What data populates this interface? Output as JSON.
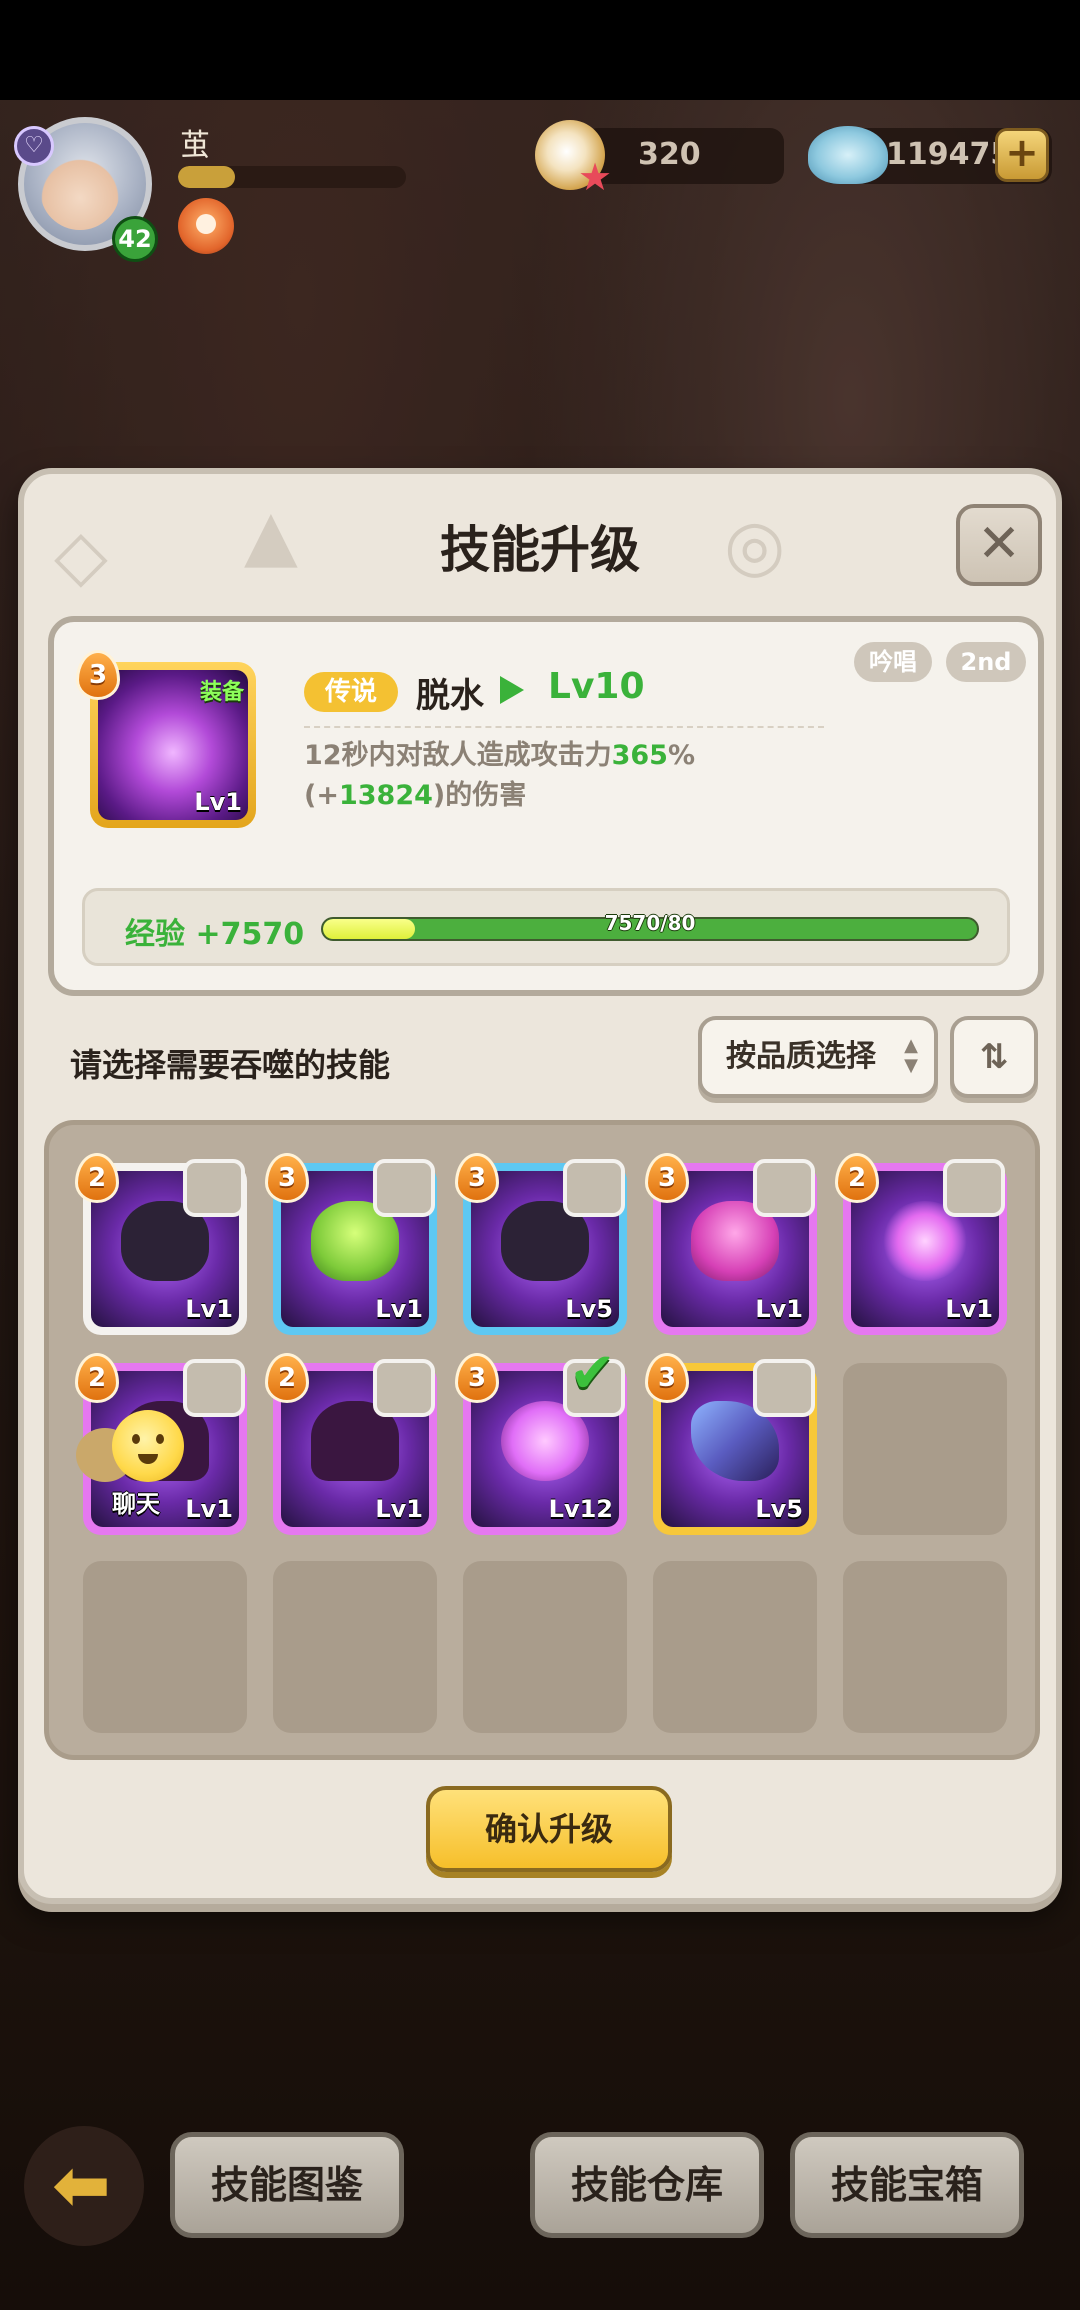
{
  "hud": {
    "player_name": "茧",
    "player_level": "42",
    "player_exp_fraction": 0.25,
    "currency_1_value": "320",
    "currency_2_value": "119475",
    "plus_label": "+"
  },
  "modal": {
    "title": "技能升级",
    "close_label": "✕",
    "skill": {
      "rank": "3",
      "equip_label": "装备",
      "icon_level": "Lv1",
      "rarity": "传说",
      "name": "脱水",
      "level": "Lv10",
      "tag_1": "吟唱",
      "tag_2": "2nd",
      "desc_1": "12秒内对敌人造成攻击力",
      "desc_pct": "365",
      "desc_2": "%(+",
      "desc_bonus": "13824",
      "desc_3": ")的伤害",
      "exp_label": "经验 +7570",
      "exp_text": "7570/80",
      "exp_fraction": 0.14
    },
    "select_label": "请选择需要吞噬的技能",
    "quality_select_label": "按品质选择",
    "sort_icon": "sort-icon",
    "confirm_label": "确认升级",
    "chat_label": "聊天",
    "slots": [
      {
        "rank": "2",
        "level": "Lv1",
        "quality": "white",
        "checked": false
      },
      {
        "rank": "3",
        "level": "Lv1",
        "quality": "blue",
        "checked": false
      },
      {
        "rank": "3",
        "level": "Lv5",
        "quality": "blue",
        "checked": false
      },
      {
        "rank": "3",
        "level": "Lv1",
        "quality": "purple",
        "checked": false
      },
      {
        "rank": "2",
        "level": "Lv1",
        "quality": "purple",
        "checked": false
      },
      {
        "rank": "2",
        "level": "Lv1",
        "quality": "purple",
        "checked": false
      },
      {
        "rank": "2",
        "level": "Lv1",
        "quality": "purple",
        "checked": false
      },
      {
        "rank": "3",
        "level": "Lv12",
        "quality": "purple",
        "checked": true
      },
      {
        "rank": "3",
        "level": "Lv5",
        "quality": "gold",
        "checked": false
      }
    ]
  },
  "bottom_bar": {
    "back_icon": "back-arrow-icon",
    "codex_label": "技能图鉴",
    "storage_label": "技能仓库",
    "chest_label": "技能宝箱"
  },
  "colors": {
    "accent_green": "#3ab23a",
    "legend_gold": "#f4c132",
    "confirm_yellow": "#f6bf2a"
  }
}
